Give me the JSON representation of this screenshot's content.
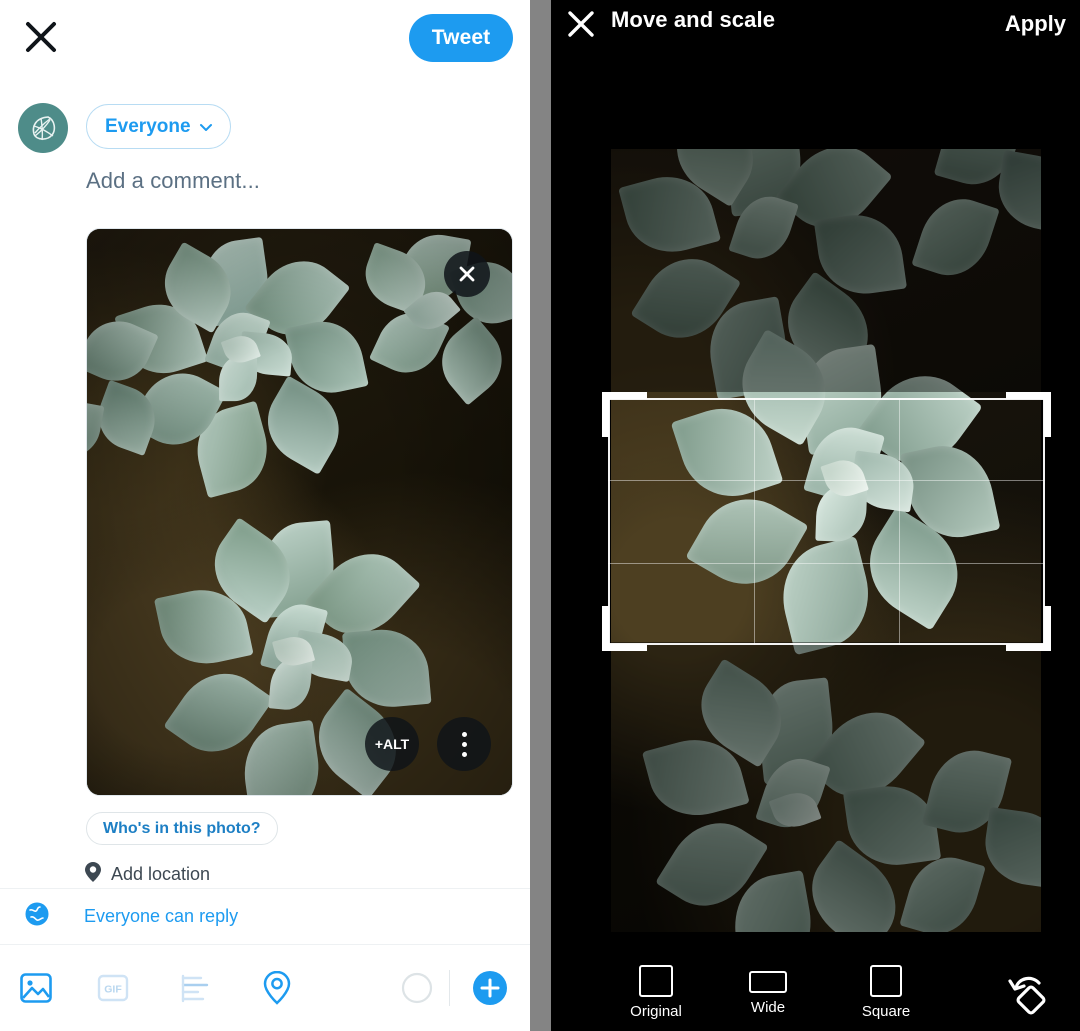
{
  "compose": {
    "close_icon": "close-icon",
    "tweet_button": "Tweet",
    "avatar_icon": "leaf-globe-avatar",
    "audience": {
      "label": "Everyone",
      "chevron_icon": "chevron-down-icon"
    },
    "comment_placeholder": "Add a comment...",
    "photo": {
      "remove_icon": "close-icon",
      "alt_button": "+ALT",
      "more_icon": "more-vertical-icon",
      "alt_label": "+ALT"
    },
    "tag_people_button": "Who's in this photo?",
    "add_location": {
      "icon": "location-pin-icon",
      "label": "Add location"
    },
    "reply_setting": {
      "icon": "globe-icon",
      "label": "Everyone can reply"
    },
    "toolbar": [
      {
        "name": "media-icon",
        "label": "Media",
        "state": "active"
      },
      {
        "name": "gif-icon",
        "label": "GIF",
        "state": "disabled"
      },
      {
        "name": "poll-icon",
        "label": "Poll",
        "state": "dim"
      },
      {
        "name": "location-icon",
        "label": "Location",
        "state": "enabled"
      },
      {
        "name": "character-count-ring",
        "label": "",
        "state": "empty"
      },
      {
        "name": "add-tweet-button",
        "label": "+",
        "state": "active"
      }
    ]
  },
  "cropper": {
    "close_icon": "close-icon",
    "title": "Move and scale",
    "apply_button": "Apply",
    "aspect_ratios": [
      {
        "label": "Original",
        "icon": "rect-original-icon"
      },
      {
        "label": "Wide",
        "icon": "rect-wide-icon"
      },
      {
        "label": "Square",
        "icon": "rect-square-icon"
      }
    ],
    "rotate_button": {
      "label": "",
      "icon": "rotate-icon"
    }
  },
  "colors": {
    "twitter_blue": "#1d9bf0",
    "avatar_teal": "#4e8c89",
    "text_secondary": "#5b7083",
    "panel_divider": "#848484",
    "crop_bg": "#000000"
  }
}
